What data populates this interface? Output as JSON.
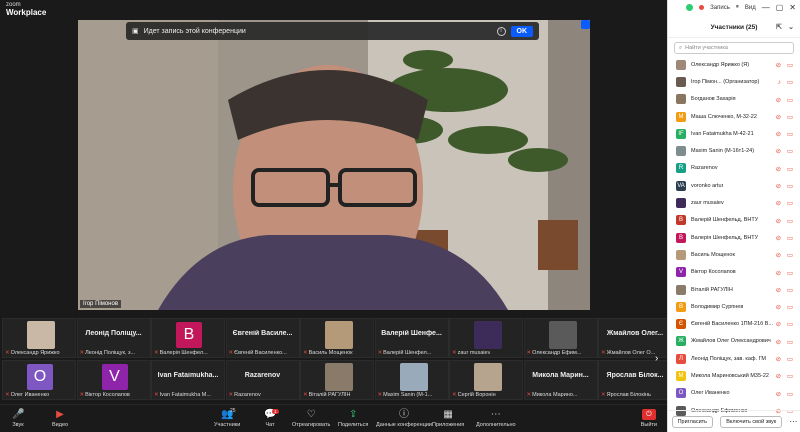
{
  "app": {
    "brand_small": "zoom",
    "brand": "Workplace",
    "record_label": "Запись",
    "view_label": "Вид"
  },
  "recording_banner": {
    "text": "Идет запись этой конференции",
    "ok": "OK"
  },
  "main_video": {
    "name": "Ігор Пімонов"
  },
  "gallery": [
    {
      "big": "",
      "name": "Олександр Ярижко",
      "type": "photo",
      "color": "#c9b8a6"
    },
    {
      "big": "Леонід Поліщу...",
      "name": "Леонід Поліщук, з...",
      "type": "text"
    },
    {
      "big": "",
      "name": "Валерія Шенфел...",
      "type": "letter",
      "letter": "В",
      "color": "#c2185b"
    },
    {
      "big": "Євгеній Василе...",
      "name": "Євгеній Василенко...",
      "type": "text"
    },
    {
      "big": "",
      "name": "Василь Мощенок",
      "type": "photo",
      "color": "#b59a7a"
    },
    {
      "big": "Валерій Шенфе...",
      "name": "Валерій Шенфел...",
      "type": "text"
    },
    {
      "big": "",
      "name": "zaur musaiev",
      "type": "photo",
      "color": "#3d2b5a"
    },
    {
      "big": "",
      "name": "Олександр Ефим...",
      "type": "photo",
      "color": "#5a5a5a"
    },
    {
      "big": "Жмайлов Олег...",
      "name": "Жмайлов Олег О...",
      "type": "text"
    },
    {
      "big": "",
      "name": "Олег Иваненко",
      "type": "letter",
      "letter": "О",
      "color": "#7e57c2"
    },
    {
      "big": "",
      "name": "Віктор Косолапов",
      "type": "letter",
      "letter": "V",
      "color": "#8e24aa"
    },
    {
      "big": "Ivan Fataimukha...",
      "name": "Ivan Fataimukha M...",
      "type": "text"
    },
    {
      "big": "Razarenov",
      "name": "Razarenov",
      "type": "text"
    },
    {
      "big": "",
      "name": "Віталій РАГУЛІН",
      "type": "photo",
      "color": "#8a7a6a"
    },
    {
      "big": "",
      "name": "Maxim Sanin (М-1...",
      "type": "photo",
      "color": "#9ab"
    },
    {
      "big": "",
      "name": "Сергій Воронін",
      "type": "photo",
      "color": "#b7a48e"
    },
    {
      "big": "Микола Марин...",
      "name": "Микола Марино...",
      "type": "text"
    },
    {
      "big": "Ярослав Білок...",
      "name": "Ярослав Білокінь",
      "type": "text"
    }
  ],
  "toolbar": {
    "audio": "Звук",
    "video": "Видео",
    "participants": "Участники",
    "participants_count": "25",
    "chat": "Чат",
    "chat_badge": "1",
    "react": "Отреагировать",
    "share": "Поделиться",
    "info": "Данные конференции",
    "apps": "Приложения",
    "more": "Дополнительно",
    "leave": "Выйти"
  },
  "panel": {
    "title": "Участники (25)",
    "search_placeholder": "Найти участника",
    "participants": [
      {
        "name": "Олександр Ярижко (Я)",
        "initial": "",
        "color": "#a08878",
        "icons": "⊘ ▭"
      },
      {
        "name": "Ігор Пімон... (Организатор)",
        "initial": "",
        "color": "#6a5a50",
        "icons": "♪ ▭"
      },
      {
        "name": "Богданов Захарія",
        "initial": "",
        "color": "#8a7560",
        "icons": "⊘ ▭"
      },
      {
        "name": "Маша Слюченко, М-32-22",
        "initial": "M",
        "color": "#f39c12",
        "icons": "⊘ ▭"
      },
      {
        "name": "Ivan Fataimukha M-42-21",
        "initial": "IF",
        "color": "#27ae60",
        "icons": "⊘ ▭"
      },
      {
        "name": "Maxim Sanin (М-16т1-24)",
        "initial": "",
        "color": "#7f8c8d",
        "icons": "⊘ ▭"
      },
      {
        "name": "Razarenov",
        "initial": "R",
        "color": "#16a085",
        "icons": "⊘ ▭"
      },
      {
        "name": "voronko artur",
        "initial": "VA",
        "color": "#2c3e50",
        "icons": "⊘ ▭"
      },
      {
        "name": "zaur musaiev",
        "initial": "",
        "color": "#3d2b5a",
        "icons": "⊘ ▭"
      },
      {
        "name": "Валерій Шенфельд, ВНТУ",
        "initial": "В",
        "color": "#c0392b",
        "icons": "⊘ ▭"
      },
      {
        "name": "Валерія Шенфельд, ВНТУ",
        "initial": "В",
        "color": "#c2185b",
        "icons": "⊘ ▭"
      },
      {
        "name": "Василь Мощенок",
        "initial": "",
        "color": "#b59a7a",
        "icons": "⊘ ▭"
      },
      {
        "name": "Віктор Косолапов",
        "initial": "V",
        "color": "#8e24aa",
        "icons": "⊘ ▭"
      },
      {
        "name": "Віталій РАГУЛІН",
        "initial": "",
        "color": "#8a7a6a",
        "icons": "⊘ ▭"
      },
      {
        "name": "Володимир Сурпнев",
        "initial": "В",
        "color": "#f39c12",
        "icons": "⊘ ▭"
      },
      {
        "name": "Євгеній Василенко 1ПМ-21б В...",
        "initial": "Є",
        "color": "#d35400",
        "icons": "⊘ ▭"
      },
      {
        "name": "Жмайлов Олег Олександрович",
        "initial": "Ж",
        "color": "#27ae60",
        "icons": "⊘ ▭"
      },
      {
        "name": "Леонід Поліщук, зав. каф. ГМ",
        "initial": "Л",
        "color": "#e74c3c",
        "icons": "⊘ ▭"
      },
      {
        "name": "Микола Мариновський М35-22",
        "initial": "М",
        "color": "#f1c40f",
        "icons": "⊘ ▭"
      },
      {
        "name": "Олег Иваненко",
        "initial": "О",
        "color": "#7e57c2",
        "icons": "⊘ ▭"
      },
      {
        "name": "Олександр Ефименко",
        "initial": "",
        "color": "#5a5a5a",
        "icons": "⊘ ▭"
      }
    ],
    "invite": "Пригласить",
    "mute_all": "Включить свой звук"
  }
}
